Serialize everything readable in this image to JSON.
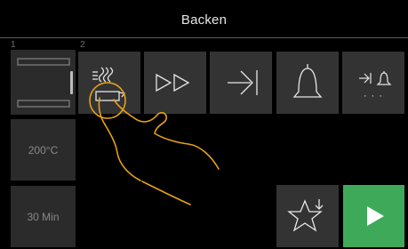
{
  "header": {
    "title": "Backen"
  },
  "slots": {
    "slot1_label": "1",
    "slot2_label": "2"
  },
  "sidebar": {
    "preview_icon": "oven-level-preview-icon",
    "temperature": "200°C",
    "duration": "30 Min"
  },
  "toolbar": {
    "items": [
      {
        "name": "steam-program-icon"
      },
      {
        "name": "fast-forward-icon"
      },
      {
        "name": "skip-to-end-icon"
      },
      {
        "name": "bell-icon"
      },
      {
        "name": "end-bell-more-icon",
        "more": "· · ·"
      }
    ]
  },
  "actions": {
    "favorite_icon": "star-download-icon",
    "start_icon": "play-icon"
  },
  "colors": {
    "tile": "#333333",
    "tile_dim": "#2b2b2b",
    "start": "#3fa95a",
    "gesture": "#e6a11a"
  }
}
